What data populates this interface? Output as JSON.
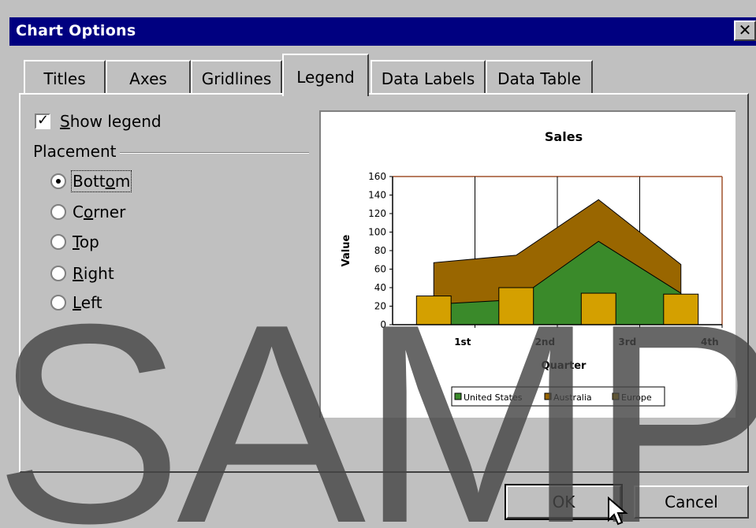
{
  "dialog": {
    "title": "Chart Options",
    "close_label": "✕"
  },
  "tabs": [
    {
      "label": "Titles"
    },
    {
      "label": "Axes"
    },
    {
      "label": "Gridlines"
    },
    {
      "label": "Legend",
      "active": true
    },
    {
      "label": "Data Labels"
    },
    {
      "label": "Data Table"
    }
  ],
  "legend_tab": {
    "show_legend_label": "Show legend",
    "show_legend_checked": true,
    "placement_label": "Placement",
    "placement_options": [
      "Bottom",
      "Corner",
      "Top",
      "Right",
      "Left"
    ],
    "placement_selected": "Bottom"
  },
  "chart_data": {
    "type": "area",
    "title": "Sales",
    "xlabel": "Quarter",
    "ylabel": "Value",
    "categories": [
      "1st",
      "2nd",
      "3rd",
      "4th"
    ],
    "ylim": [
      0,
      160
    ],
    "yticks": [
      0,
      20,
      40,
      60,
      80,
      100,
      120,
      140,
      160
    ],
    "series": [
      {
        "name": "United States",
        "type": "area",
        "color": "#3a8a2a",
        "values": [
          22,
          27,
          90,
          34
        ]
      },
      {
        "name": "Australia",
        "type": "area",
        "color": "#996600",
        "values": [
          67,
          75,
          135,
          65
        ]
      },
      {
        "name": "Europe",
        "type": "bar",
        "color": "#d4a000",
        "values": [
          31,
          40,
          34,
          33
        ]
      }
    ],
    "legend_position": "bottom",
    "grid": "vertical"
  },
  "buttons": {
    "ok_label": "OK",
    "cancel_label": "Cancel"
  },
  "watermark": "SAMPL"
}
